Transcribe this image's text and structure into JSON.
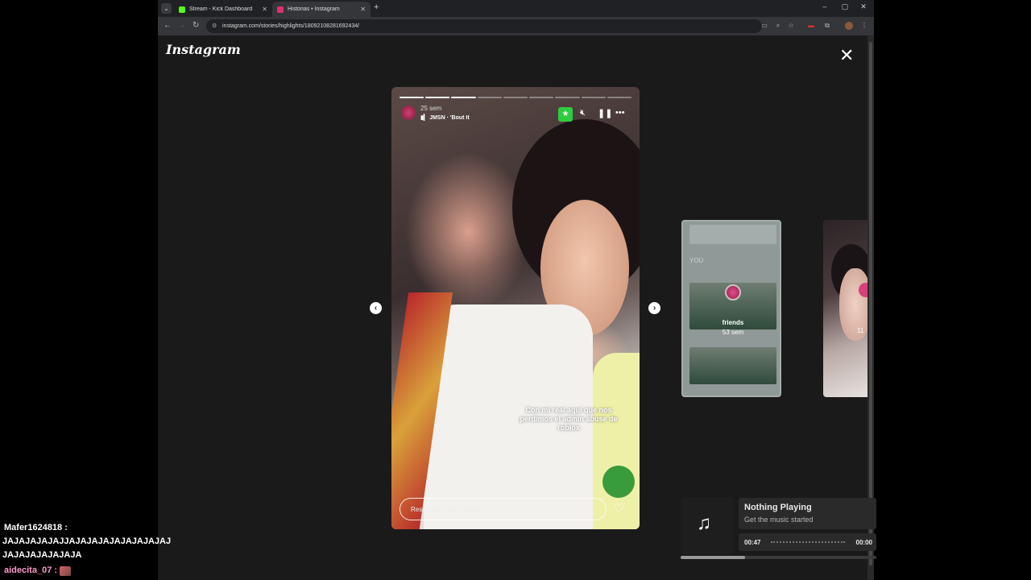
{
  "browser": {
    "tabs": [
      {
        "title": "Stream - Kick Dashboard",
        "favicon_color": "#53fc18",
        "active": false
      },
      {
        "title": "Historias • Instagram",
        "favicon_color": "#e1306c",
        "active": true
      }
    ],
    "url": "instagram.com/stories/highlights/18092108281692434/"
  },
  "instagram": {
    "logo": "Instagram",
    "story": {
      "time_ago": "25 sem",
      "song": "JMSN · 'Bout It",
      "progress_segments": 9,
      "progress_done": 3,
      "caption": "Con mi real aqui que nos perdimos el admin abuse de roblox",
      "reply_placeholder": "Responde a scar_swiftie..."
    },
    "next_highlight": {
      "name": "friends",
      "time_ago": "53 sem",
      "overlay_text": "YOU"
    },
    "next_highlight_2": {
      "time_ago": "11"
    }
  },
  "chat": {
    "messages": [
      {
        "user": "Mafer1624818 :",
        "text_lines": [
          "JAJAJAJAJAJJAJAJAJAJAJAJAJAJAJ",
          "JAJAJAJAJAJAJA"
        ]
      },
      {
        "user": "aidecita_07 :",
        "text_lines": []
      }
    ]
  },
  "music_widget": {
    "title": "Nothing Playing",
    "subtitle": "Get the music started",
    "elapsed": "00:47",
    "remaining": "00:00",
    "progress": 0.33
  }
}
